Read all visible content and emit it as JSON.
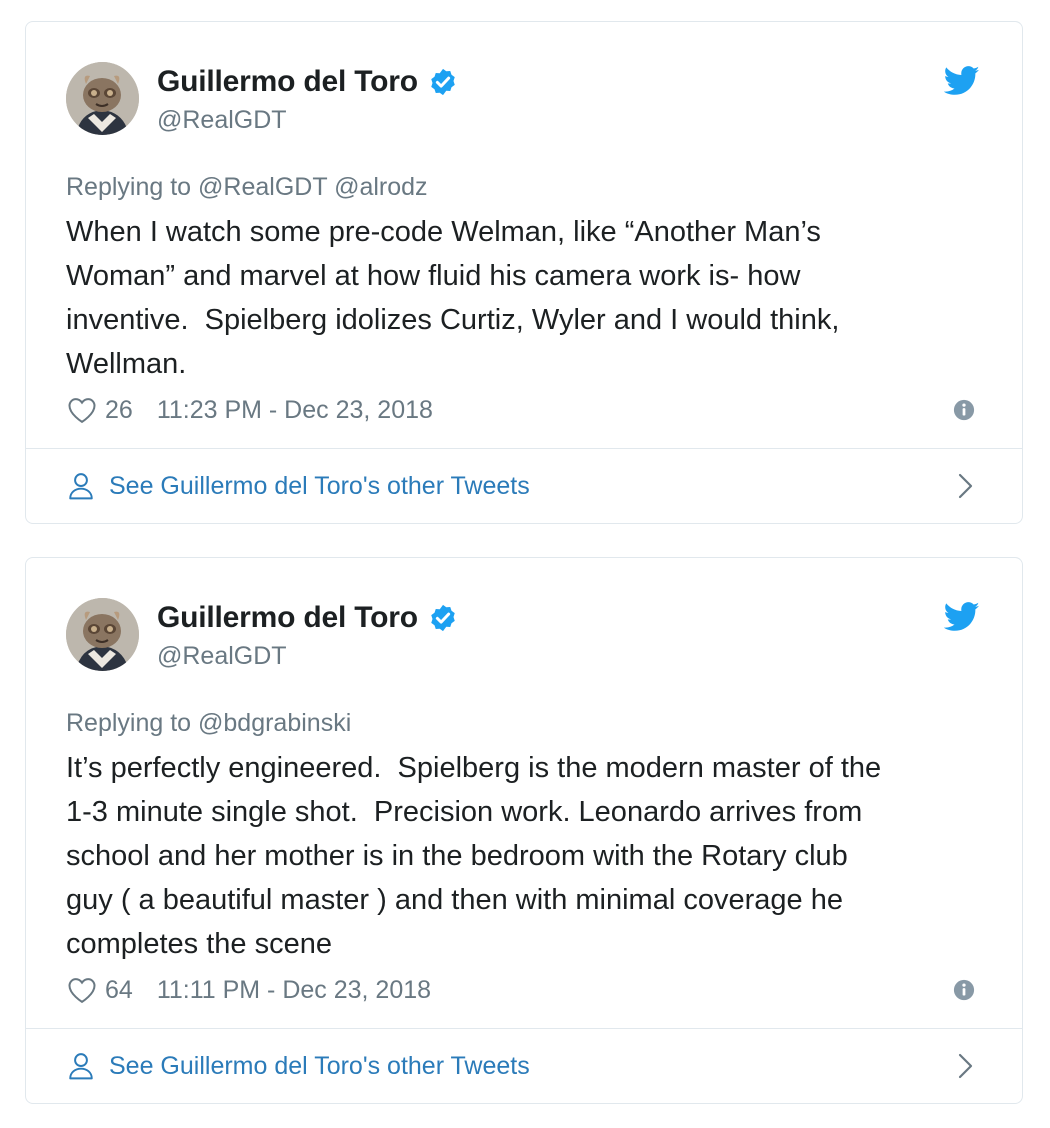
{
  "tweets": [
    {
      "author_name": "Guillermo del Toro",
      "handle": "@RealGDT",
      "replying_to": "Replying to @RealGDT @alrodz",
      "text": "When I watch some pre-code Welman, like “Another Man’s\nWoman” and marvel at how fluid his camera work is- how\ninventive.  Spielberg idolizes Curtiz, Wyler and I would think,\nWellman.",
      "likes": "26",
      "timestamp": "11:23 PM - Dec 23, 2018",
      "footer_link": "See Guillermo del Toro's other Tweets"
    },
    {
      "author_name": "Guillermo del Toro",
      "handle": "@RealGDT",
      "replying_to": "Replying to @bdgrabinski",
      "text": "It’s perfectly engineered.  Spielberg is the modern master of the\n1-3 minute single shot.  Precision work. Leonardo arrives from\nschool and her mother is in the bedroom with the Rotary club\nguy ( a beautiful master ) and then with minimal coverage he\ncompletes the scene",
      "likes": "64",
      "timestamp": "11:11 PM - Dec 23, 2018",
      "footer_link": "See Guillermo del Toro's other Tweets"
    }
  ],
  "icons": {
    "verified": "verified-badge-icon",
    "bird": "twitter-bird-icon",
    "heart": "heart-outline-icon",
    "info": "info-circle-icon",
    "user": "user-outline-icon",
    "chevron": "chevron-right-icon"
  },
  "colors": {
    "twitter_blue": "#1da1f2",
    "link_blue": "#2b7bb9",
    "text": "#1c2022",
    "muted": "#697882",
    "border": "#e1e8ed"
  }
}
